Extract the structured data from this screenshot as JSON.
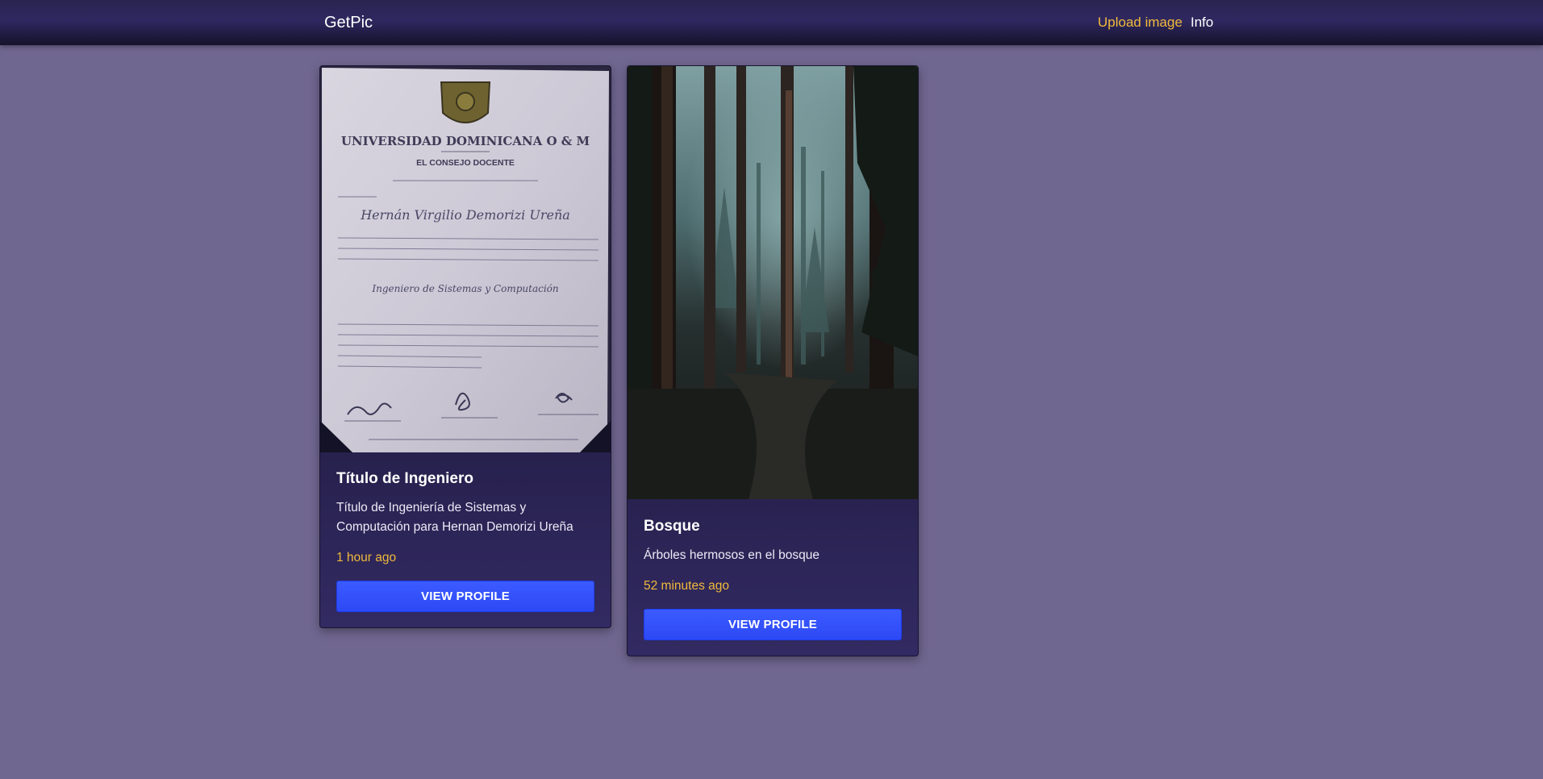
{
  "navbar": {
    "brand": "GetPic",
    "links": [
      {
        "label": "Upload image",
        "color": "#f1b93b"
      },
      {
        "label": "Info",
        "color": "#ffffff"
      }
    ]
  },
  "colors": {
    "page_background": "#706790",
    "accent": "#f1b93b",
    "button": "#2d49f5"
  },
  "cards": [
    {
      "image": {
        "emblem_text": "UNIVERSIDAD DOMINICANA O & M",
        "emblem_subtext": "EL CONSEJO DOCENTE",
        "name_text": "Hernán Virgilio Demorizi Ureña",
        "degree_text": "Ingeniero de Sistemas y Computación"
      },
      "title": "Título de Ingeniero",
      "description": "Título de Ingeniería de Sistemas y Computación para Hernan Demorizi Ureña",
      "time": "1 hour ago",
      "button_label": "VIEW PROFILE"
    },
    {
      "title": "Bosque",
      "description": "Árboles hermosos en el bosque",
      "time": "52 minutes ago",
      "button_label": "VIEW PROFILE"
    }
  ]
}
